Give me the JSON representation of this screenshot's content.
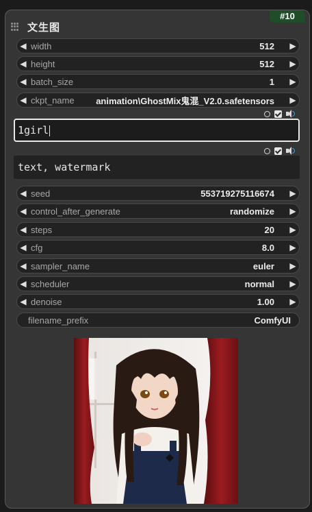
{
  "node": {
    "id_badge": "#10",
    "title": "文生图"
  },
  "widgets": [
    {
      "label": "width",
      "value": "512"
    },
    {
      "label": "height",
      "value": "512"
    },
    {
      "label": "batch_size",
      "value": "1"
    },
    {
      "label": "ckpt_name",
      "value": "animation\\GhostMix鬼混_V2.0.safetensors"
    }
  ],
  "prompts": {
    "positive": "1girl",
    "negative": "text, watermark"
  },
  "sampler_widgets": [
    {
      "label": "seed",
      "value": "553719275116674"
    },
    {
      "label": "control_after_generate",
      "value": "randomize"
    },
    {
      "label": "steps",
      "value": "20"
    },
    {
      "label": "cfg",
      "value": "8.0"
    },
    {
      "label": "sampler_name",
      "value": "euler"
    },
    {
      "label": "scheduler",
      "value": "normal"
    },
    {
      "label": "denoise",
      "value": "1.00"
    }
  ],
  "filename_prefix": {
    "label": "filename_prefix",
    "value": "ComfyUI"
  },
  "colors": {
    "accent": "#1f4d2a",
    "speaker_wave": "#3aa0d8"
  }
}
